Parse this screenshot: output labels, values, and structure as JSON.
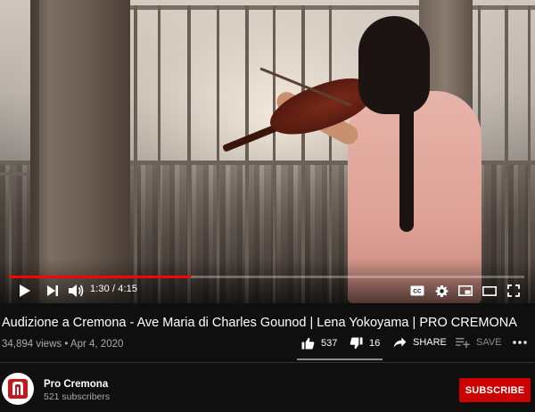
{
  "player": {
    "time_current": "1:30",
    "time_total": "4:15",
    "time_display": "1:30 / 4:15",
    "progress_fraction": 0.353,
    "controls": {
      "play_icon": "play-icon",
      "next_icon": "next-icon",
      "volume_icon": "volume-icon",
      "captions_icon": "captions-icon",
      "settings_icon": "gear-icon",
      "miniplayer_icon": "miniplayer-icon",
      "theater_icon": "theater-mode-icon",
      "fullscreen_icon": "fullscreen-icon"
    },
    "progress_color": "#ff0000"
  },
  "video": {
    "title": "Audizione a Cremona - Ave Maria di Charles Gounod | Lena Yokoyama | PRO CREMONA",
    "views": "34,894 views",
    "separator": "•",
    "date": "Apr 4, 2020"
  },
  "actions": {
    "like_count": "537",
    "dislike_count": "16",
    "share_label": "SHARE",
    "save_label": "SAVE",
    "more_icon": "more-horizontal-icon"
  },
  "channel": {
    "name": "Pro Cremona",
    "subscribers": "521 subscribers",
    "subscribe_label": "SUBSCRIBE",
    "subscribe_color": "#cc0000"
  }
}
